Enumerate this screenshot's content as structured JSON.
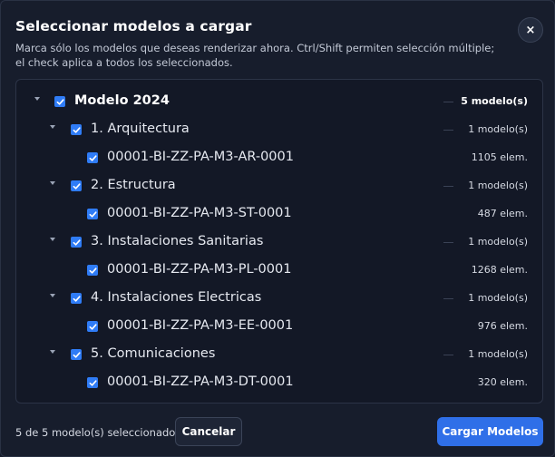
{
  "dialog": {
    "title": "Seleccionar modelos a cargar",
    "subtitle": "Marca sólo los modelos que deseas renderizar ahora. Ctrl/Shift permiten selección múltiple; el check aplica a todos los seleccionados.",
    "close_label": "×"
  },
  "tree": {
    "root": {
      "label": "Modelo 2024",
      "count": "5 modelo(s)",
      "checked": true
    },
    "groups": [
      {
        "label": "1. Arquitectura",
        "count": "1 modelo(s)",
        "checked": true,
        "model": {
          "label": "00001-BI-ZZ-PA-M3-AR-0001",
          "count": "1105 elem.",
          "checked": true
        }
      },
      {
        "label": "2. Estructura",
        "count": "1 modelo(s)",
        "checked": true,
        "model": {
          "label": "00001-BI-ZZ-PA-M3-ST-0001",
          "count": "487 elem.",
          "checked": true
        }
      },
      {
        "label": "3. Instalaciones Sanitarias",
        "count": "1 modelo(s)",
        "checked": true,
        "model": {
          "label": "00001-BI-ZZ-PA-M3-PL-0001",
          "count": "1268 elem.",
          "checked": true
        }
      },
      {
        "label": "4. Instalaciones Electricas",
        "count": "1 modelo(s)",
        "checked": true,
        "model": {
          "label": "00001-BI-ZZ-PA-M3-EE-0001",
          "count": "976 elem.",
          "checked": true
        }
      },
      {
        "label": "5. Comunicaciones",
        "count": "1 modelo(s)",
        "checked": true,
        "model": {
          "label": "00001-BI-ZZ-PA-M3-DT-0001",
          "count": "320 elem.",
          "checked": true
        }
      }
    ]
  },
  "footer": {
    "status": "5 de 5 modelo(s) seleccionados",
    "cancel_label": "Cancelar",
    "load_label": "Cargar Modelos"
  },
  "colors": {
    "accent": "#2f6fe8",
    "checkbox": "#2f7cf6",
    "background": "#171d2c"
  }
}
